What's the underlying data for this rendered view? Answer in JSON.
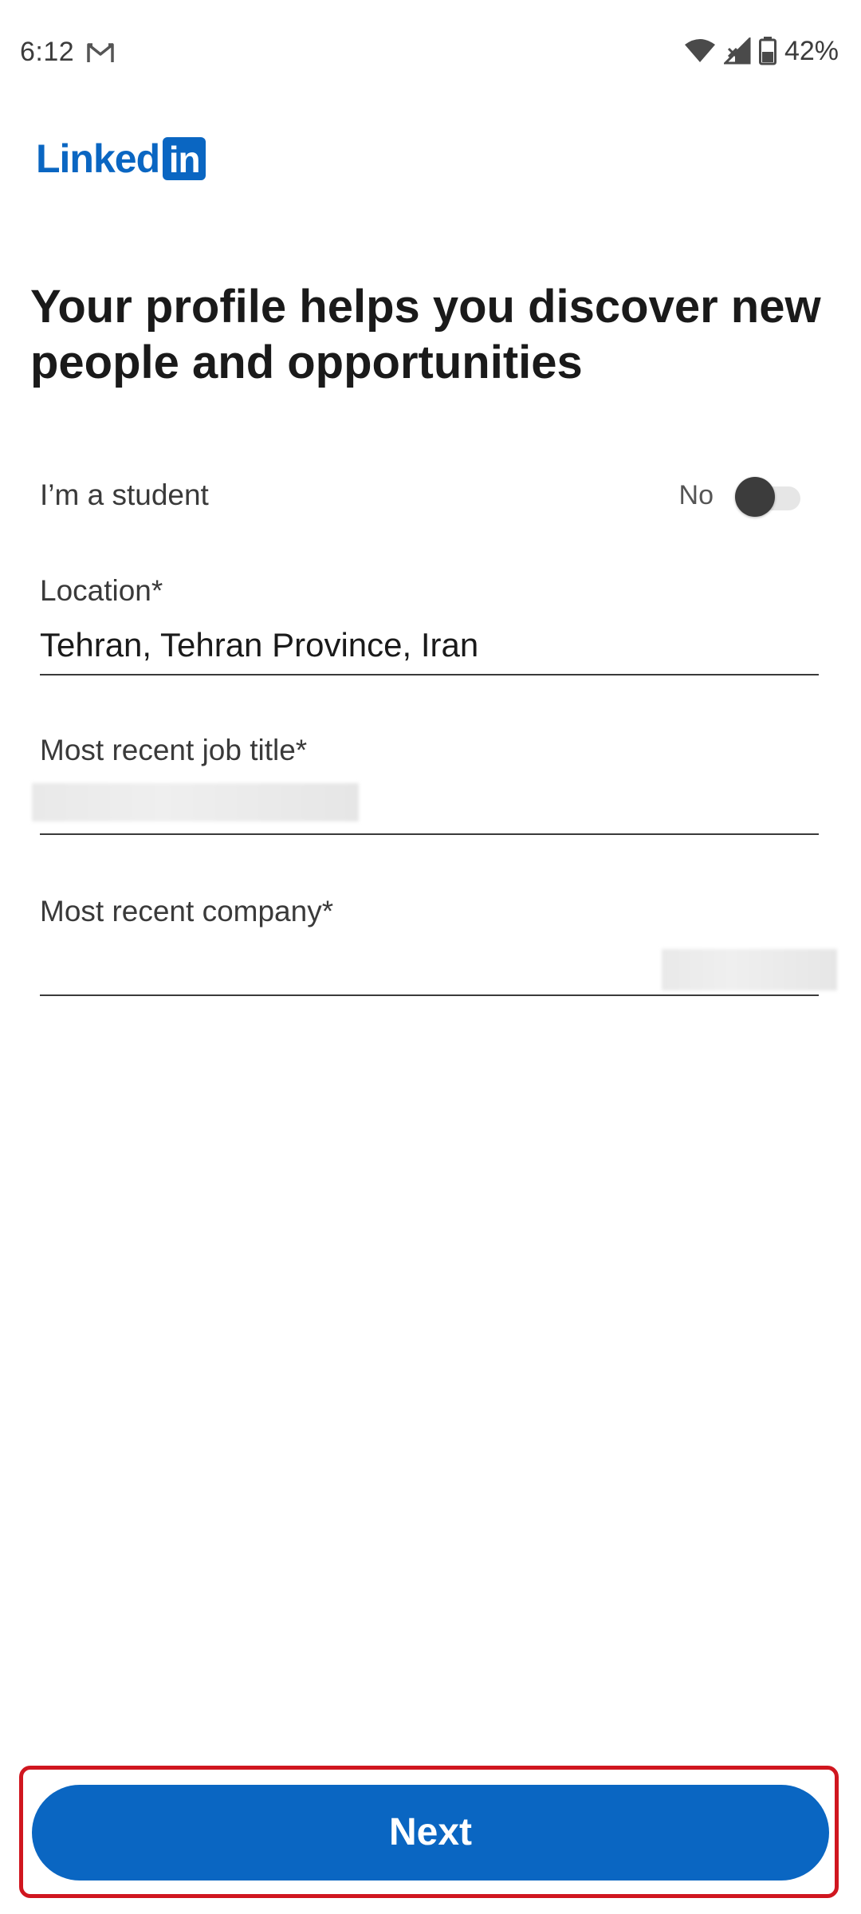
{
  "status_bar": {
    "time": "6:12",
    "battery_percent": "42%",
    "icons": [
      "gmail-icon",
      "wifi-icon",
      "signal-icon",
      "battery-icon"
    ]
  },
  "brand": {
    "logo_word": "Linked",
    "logo_box": "in",
    "accent_color": "#0a66c2"
  },
  "headline": "Your profile helps you discover new people and opportunities",
  "student": {
    "label": "I’m a student",
    "state_text": "No",
    "checked": false
  },
  "fields": {
    "location": {
      "label": "Location*",
      "value": "Tehran, Tehran Province, Iran"
    },
    "job_title": {
      "label": "Most recent job title*",
      "value": ""
    },
    "company": {
      "label": "Most recent company*",
      "value": ""
    }
  },
  "actions": {
    "next_label": "Next",
    "highlight_color": "#d0161f"
  }
}
